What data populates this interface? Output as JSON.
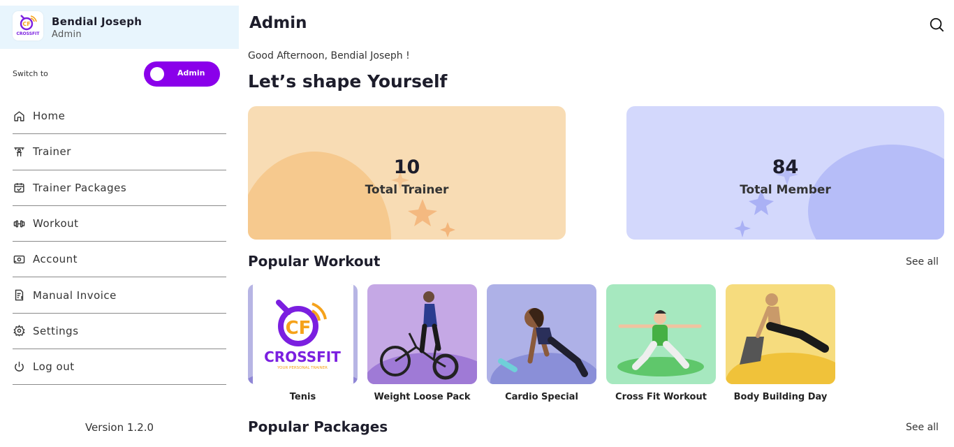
{
  "profile": {
    "name": "Bendial Joseph",
    "role": "Admin",
    "logo_text": "CROSSFIT"
  },
  "switch": {
    "label": "Switch to",
    "value": "Admin"
  },
  "nav": {
    "items": [
      {
        "label": "Home",
        "icon": "home-icon"
      },
      {
        "label": "Trainer",
        "icon": "trainer-icon"
      },
      {
        "label": "Trainer Packages",
        "icon": "calendar-check-icon"
      },
      {
        "label": "Workout",
        "icon": "dumbbell-icon"
      },
      {
        "label": "Account",
        "icon": "money-icon"
      },
      {
        "label": "Manual Invoice",
        "icon": "invoice-icon"
      },
      {
        "label": "Settings",
        "icon": "gear-icon"
      },
      {
        "label": "Log out",
        "icon": "power-icon"
      }
    ]
  },
  "version": "Version 1.2.0",
  "header": {
    "title": "Admin",
    "search_icon": "search-icon"
  },
  "greeting": "Good Afternoon, Bendial Joseph !",
  "headline": "Let’s shape Yourself",
  "stats": {
    "trainer": {
      "value": "10",
      "label": "Total Trainer",
      "color": "#f8dcb4"
    },
    "member": {
      "value": "84",
      "label": "Total Member",
      "color": "#d3d8fc"
    }
  },
  "popular_workout": {
    "title": "Popular Workout",
    "see_all": "See all",
    "items": [
      {
        "name": "Tenis",
        "logo_text": "CROSSFIT",
        "logo_tagline": "YOUR PERSONAL TRAINER",
        "color": "#b7b5e4"
      },
      {
        "name": "Weight Loose Pack",
        "color": "#c5a8e5"
      },
      {
        "name": "Cardio Special",
        "color": "#aeb1e7"
      },
      {
        "name": "Cross Fit Workout",
        "color": "#a6e8bf"
      },
      {
        "name": "Body Building Day",
        "color": "#f6dc7e"
      }
    ]
  },
  "popular_packages": {
    "title": "Popular Packages",
    "see_all": "See all"
  },
  "colors": {
    "accent": "#8a00ea",
    "profile_bg": "#e8f5fd",
    "logo_orange": "#f5a21b"
  }
}
